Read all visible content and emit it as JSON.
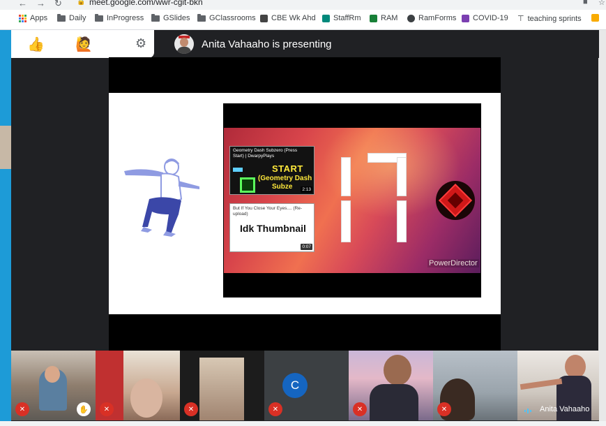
{
  "browser": {
    "url": "meet.google.com/wwr-cgit-bkn",
    "bookmarks": [
      {
        "label": "Apps",
        "icon": "apps-grid-icon"
      },
      {
        "label": "Daily",
        "icon": "folder-icon"
      },
      {
        "label": "InProgress",
        "icon": "folder-icon"
      },
      {
        "label": "GSlides",
        "icon": "folder-icon"
      },
      {
        "label": "GClassrooms",
        "icon": "folder-icon"
      },
      {
        "label": "CBE Wk Ahd",
        "icon": "cbe-icon"
      },
      {
        "label": "StaffRm",
        "icon": "meet-icon"
      },
      {
        "label": "RAM",
        "icon": "sheets-icon"
      },
      {
        "label": "RamForms",
        "icon": "globe-icon"
      },
      {
        "label": "COVID-19",
        "icon": "onenote-icon"
      },
      {
        "label": "teaching sprints",
        "icon": "pin-icon"
      }
    ]
  },
  "meet": {
    "presenting_text": "Anita Vahaaho is presenting",
    "reaction_icons": [
      "thumbs-up-icon",
      "raise-hand-icon",
      "settings-icon"
    ]
  },
  "slide": {
    "video": {
      "thumb1_title": "Geometry Dash Subzero (Press Start) | DwarpyPlays",
      "thumb1_art_main": "START",
      "thumb1_art_sub": "(Geometry Dash",
      "thumb1_art_sub2": "Subze",
      "thumb1_duration": "2:13",
      "thumb2_title": "But If You Close Your Eyes.... (Re-upload)",
      "thumb2_main": "Idk Thumbnail",
      "thumb2_duration": "0:07",
      "countdown": "17",
      "watermark": "PowerDirector"
    }
  },
  "participants": [
    {
      "mic": "muted",
      "hand_raised": true
    },
    {
      "mic": "muted"
    },
    {
      "mic": "muted"
    },
    {
      "mic": "muted",
      "avatar_letter": "C"
    },
    {
      "mic": "muted"
    },
    {
      "mic": "muted"
    },
    {
      "name": "Anita Vahaaho",
      "speaking": true
    }
  ]
}
